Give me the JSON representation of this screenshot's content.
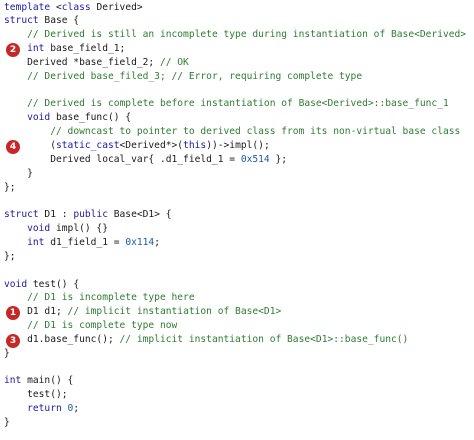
{
  "lines": [
    {
      "parts": [
        [
          "kw",
          "template"
        ],
        [
          "pl",
          " <"
        ],
        [
          "kw",
          "class"
        ],
        [
          "pl",
          " Derived>"
        ]
      ]
    },
    {
      "parts": [
        [
          "kw",
          "struct"
        ],
        [
          "pl",
          " Base {"
        ]
      ]
    },
    {
      "parts": [
        [
          "pl",
          "    "
        ],
        [
          "cm",
          "// Derived is still an incomplete type during instantiation of Base<Derived>"
        ]
      ]
    },
    {
      "parts": [
        [
          "pl",
          "    "
        ],
        [
          "kw",
          "int"
        ],
        [
          "pl",
          " base_field_1;"
        ]
      ]
    },
    {
      "parts": [
        [
          "pl",
          "    Derived *base_field_2; "
        ],
        [
          "cm",
          "// OK"
        ]
      ]
    },
    {
      "parts": [
        [
          "pl",
          "    "
        ],
        [
          "cm",
          "// Derived base_filed_3; // Error, requiring complete type"
        ]
      ]
    },
    {
      "parts": [
        [
          "pl",
          ""
        ]
      ]
    },
    {
      "parts": [
        [
          "pl",
          "    "
        ],
        [
          "cm",
          "// Derived is complete before instantiation of Base<Derived>::base_func_1"
        ]
      ]
    },
    {
      "parts": [
        [
          "pl",
          "    "
        ],
        [
          "kw",
          "void"
        ],
        [
          "pl",
          " base_func() {"
        ]
      ]
    },
    {
      "parts": [
        [
          "pl",
          "        "
        ],
        [
          "cm",
          "// downcast to pointer to derived class from its non-virtual base class"
        ]
      ]
    },
    {
      "parts": [
        [
          "pl",
          "        ("
        ],
        [
          "kw",
          "static_cast"
        ],
        [
          "pl",
          "<Derived*>("
        ],
        [
          "kw",
          "this"
        ],
        [
          "pl",
          "))->impl();"
        ]
      ]
    },
    {
      "parts": [
        [
          "pl",
          "        Derived local_var{ .d1_field_1 = "
        ],
        [
          "num",
          "0x514"
        ],
        [
          "pl",
          " };"
        ]
      ]
    },
    {
      "parts": [
        [
          "pl",
          "    }"
        ]
      ]
    },
    {
      "parts": [
        [
          "pl",
          "};"
        ]
      ]
    },
    {
      "parts": [
        [
          "pl",
          ""
        ]
      ]
    },
    {
      "parts": [
        [
          "kw",
          "struct"
        ],
        [
          "pl",
          " D1 : "
        ],
        [
          "kw",
          "public"
        ],
        [
          "pl",
          " Base<D1> {"
        ]
      ]
    },
    {
      "parts": [
        [
          "pl",
          "    "
        ],
        [
          "kw",
          "void"
        ],
        [
          "pl",
          " impl() {}"
        ]
      ]
    },
    {
      "parts": [
        [
          "pl",
          "    "
        ],
        [
          "kw",
          "int"
        ],
        [
          "pl",
          " d1_field_1 = "
        ],
        [
          "num",
          "0x114"
        ],
        [
          "pl",
          ";"
        ]
      ]
    },
    {
      "parts": [
        [
          "pl",
          "};"
        ]
      ]
    },
    {
      "parts": [
        [
          "pl",
          ""
        ]
      ]
    },
    {
      "parts": [
        [
          "kw",
          "void"
        ],
        [
          "pl",
          " test() {"
        ]
      ]
    },
    {
      "parts": [
        [
          "pl",
          "    "
        ],
        [
          "cm",
          "// D1 is incomplete type here"
        ]
      ]
    },
    {
      "parts": [
        [
          "pl",
          "    D1 d1; "
        ],
        [
          "cm",
          "// implicit instantiation of Base<D1>"
        ]
      ]
    },
    {
      "parts": [
        [
          "pl",
          "    "
        ],
        [
          "cm",
          "// D1 is complete type now"
        ]
      ]
    },
    {
      "parts": [
        [
          "pl",
          "    d1.base_func(); "
        ],
        [
          "cm",
          "// implicit instantiation of Base<D1>::base_func()"
        ]
      ]
    },
    {
      "parts": [
        [
          "pl",
          "}"
        ]
      ]
    },
    {
      "parts": [
        [
          "pl",
          ""
        ]
      ]
    },
    {
      "parts": [
        [
          "kw",
          "int"
        ],
        [
          "pl",
          " main() {"
        ]
      ]
    },
    {
      "parts": [
        [
          "pl",
          "    test();"
        ]
      ]
    },
    {
      "parts": [
        [
          "pl",
          "    "
        ],
        [
          "kw",
          "return"
        ],
        [
          "pl",
          " "
        ],
        [
          "num",
          "0"
        ],
        [
          "pl",
          ";"
        ]
      ]
    },
    {
      "parts": [
        [
          "pl",
          "}"
        ]
      ]
    }
  ],
  "markers": [
    {
      "label": "2",
      "line": 3
    },
    {
      "label": "4",
      "line": 10
    },
    {
      "label": "1",
      "line": 22
    },
    {
      "label": "3",
      "line": 24
    }
  ],
  "colors": {
    "keyword": "#1a1aa8",
    "comment": "#2e7d32",
    "number": "#1a5aa8",
    "marker": "#c62828"
  }
}
